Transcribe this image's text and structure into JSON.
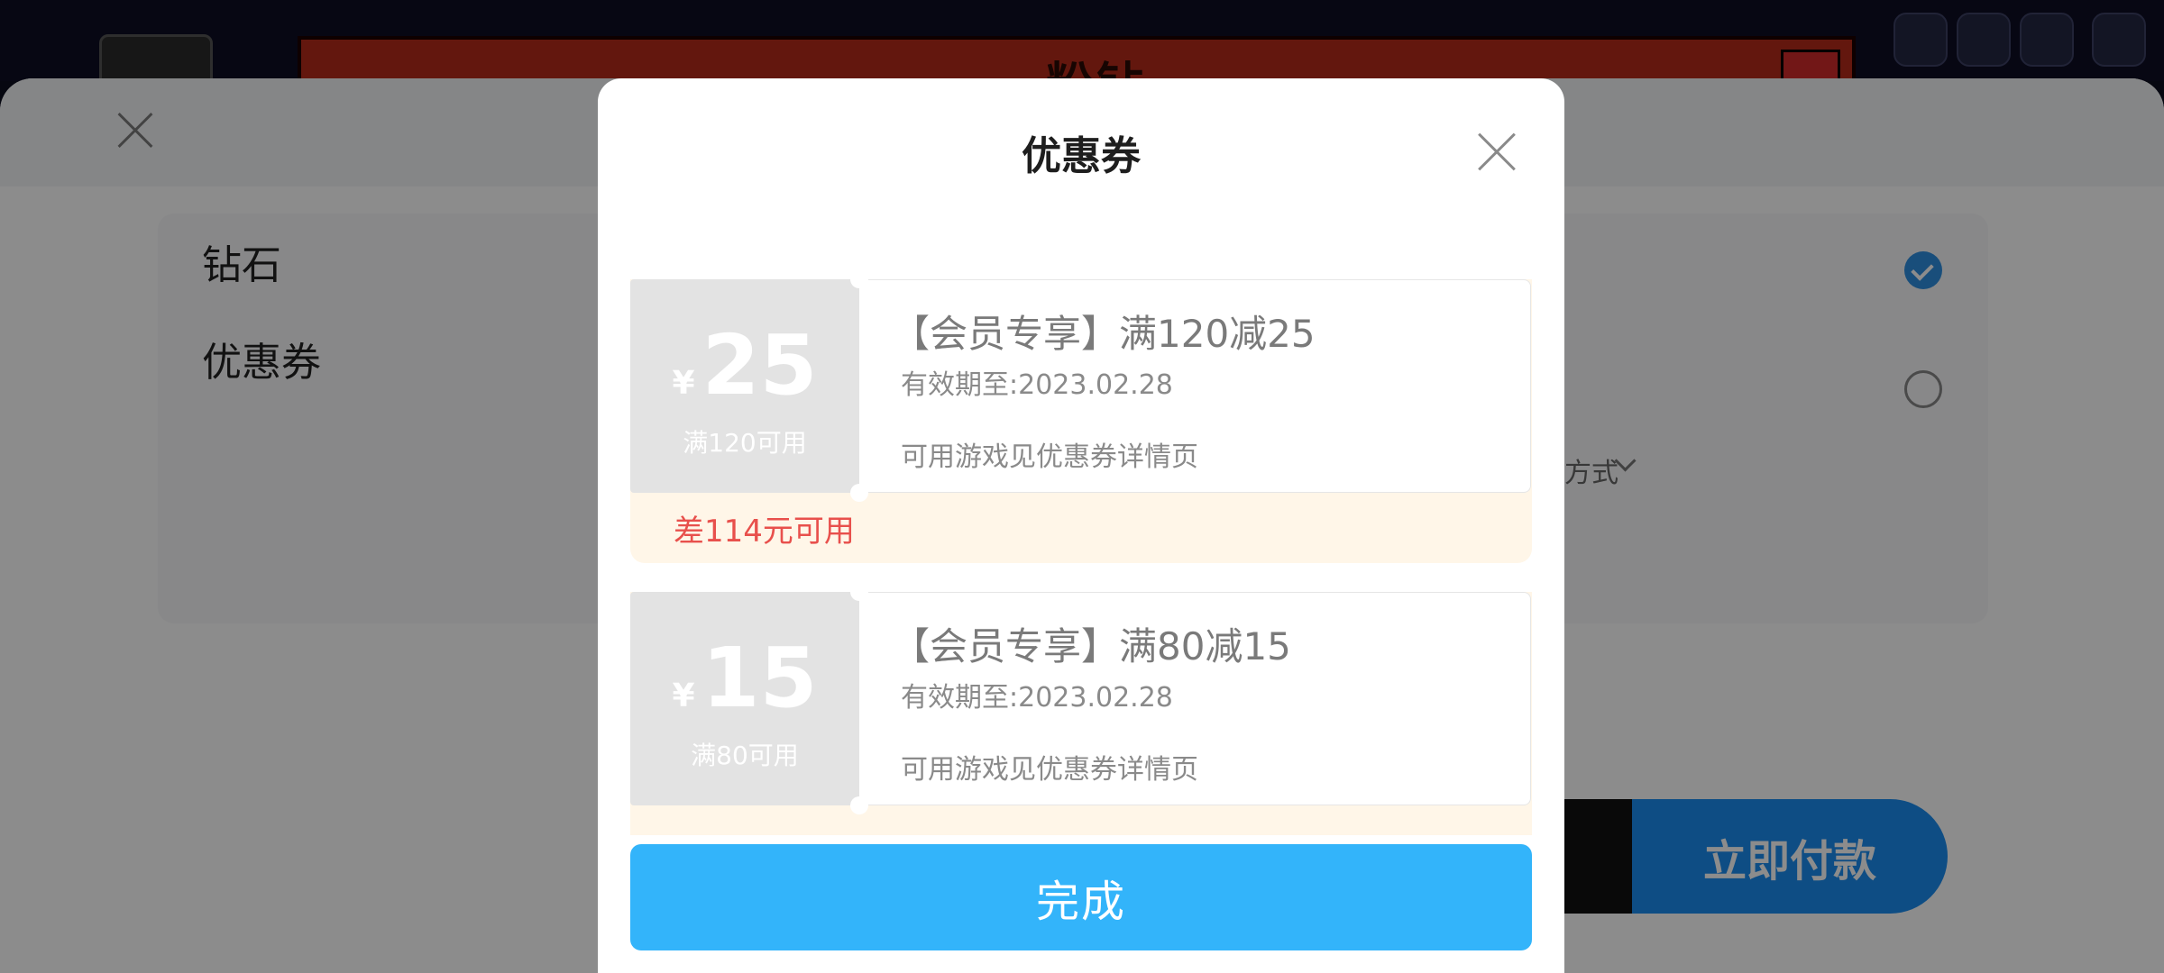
{
  "background_game": {
    "banner_text": "粉钻"
  },
  "payment_panel": {
    "rows": [
      {
        "label": "钻石",
        "selected": true
      },
      {
        "label": "优惠券",
        "selected": false
      }
    ],
    "method_text": "方式",
    "pay_button_label": "立即付款"
  },
  "coupon_modal": {
    "title": "优惠券",
    "coupons": [
      {
        "currency": "¥",
        "amount": "25",
        "condition": "满120可用",
        "title": "【会员专享】满120减25",
        "expiry": "有效期至:2023.02.28",
        "note": "可用游戏见优惠券详情页",
        "shortfall": "差114元可用"
      },
      {
        "currency": "¥",
        "amount": "15",
        "condition": "满80可用",
        "title": "【会员专享】满80减15",
        "expiry": "有效期至:2023.02.28",
        "note": "可用游戏见优惠券详情页"
      }
    ],
    "done_label": "完成"
  },
  "colors": {
    "accent_blue": "#33b4fa",
    "warning_red": "#e8504c",
    "coupon_stub_gray": "#e3e3e3",
    "coupon_footer_cream": "#fff6e8"
  }
}
